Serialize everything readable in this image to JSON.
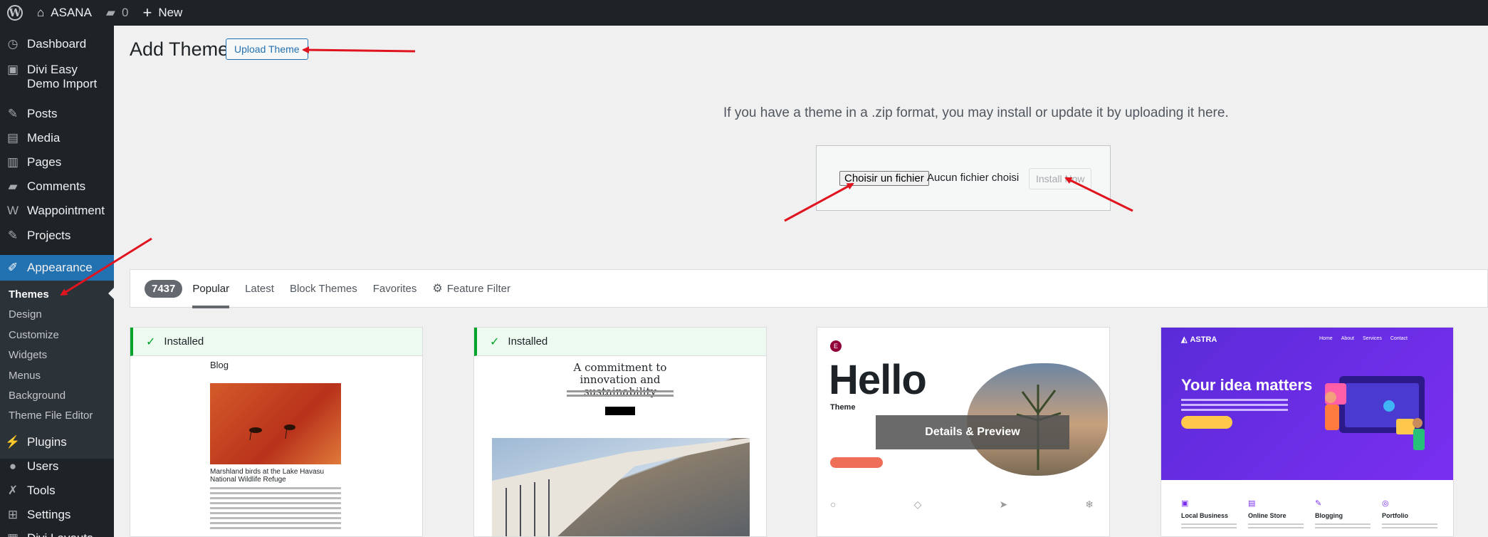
{
  "admin_bar": {
    "site_name": "ASANA",
    "comments_count": "0",
    "new_label": "New"
  },
  "sidebar": {
    "items": [
      {
        "label": "Dashboard",
        "icon": "dashboard-icon"
      },
      {
        "label": "Divi Easy Demo Import",
        "icon": "import-icon"
      },
      {
        "label": "Posts",
        "icon": "pin-icon"
      },
      {
        "label": "Media",
        "icon": "media-icon"
      },
      {
        "label": "Pages",
        "icon": "pages-icon"
      },
      {
        "label": "Comments",
        "icon": "comments-icon"
      },
      {
        "label": "Wappointment",
        "icon": "wappointment-icon"
      },
      {
        "label": "Projects",
        "icon": "pin-icon"
      },
      {
        "label": "Appearance",
        "icon": "brush-icon"
      },
      {
        "label": "Plugins",
        "icon": "plugin-icon"
      },
      {
        "label": "Users",
        "icon": "users-icon"
      },
      {
        "label": "Tools",
        "icon": "tools-icon"
      },
      {
        "label": "Settings",
        "icon": "settings-icon"
      },
      {
        "label": "Divi Layouts",
        "icon": "layouts-icon"
      }
    ],
    "appearance_submenu": [
      "Themes",
      "Design",
      "Customize",
      "Widgets",
      "Menus",
      "Background",
      "Theme File Editor"
    ]
  },
  "header": {
    "title": "Add Themes",
    "upload_button": "Upload Theme"
  },
  "upload": {
    "description": "If you have a theme in a .zip format, you may install or update it by uploading it here.",
    "file_button": "Choisir un fichier",
    "file_status": "Aucun fichier choisi",
    "install_button": "Install Now"
  },
  "filter_bar": {
    "count": "7437",
    "tabs": [
      "Popular",
      "Latest",
      "Block Themes",
      "Favorites"
    ],
    "feature_filter": "Feature Filter"
  },
  "themes": [
    {
      "installed_label": "Installed",
      "preview_title": "Blog",
      "preview_caption": "Marshland birds at the Lake Havasu National Wildlife Refuge"
    },
    {
      "installed_label": "Installed",
      "preview_heading": "A commitment to innovation and sustainability"
    },
    {
      "preview_heading": "Hello",
      "preview_sub": "Theme",
      "overlay_label": "Details & Preview"
    },
    {
      "brand": "ASTRA",
      "nav": [
        "Home",
        "About",
        "Services",
        "Contact"
      ],
      "headline": "Your idea matters",
      "categories": [
        "Local Business",
        "Online Store",
        "Blogging",
        "Portfolio"
      ]
    }
  ],
  "colors": {
    "admin_dark": "#1d2327",
    "accent": "#2271b1",
    "installed_green": "#00a32a",
    "annotation_red": "#e0141e"
  }
}
